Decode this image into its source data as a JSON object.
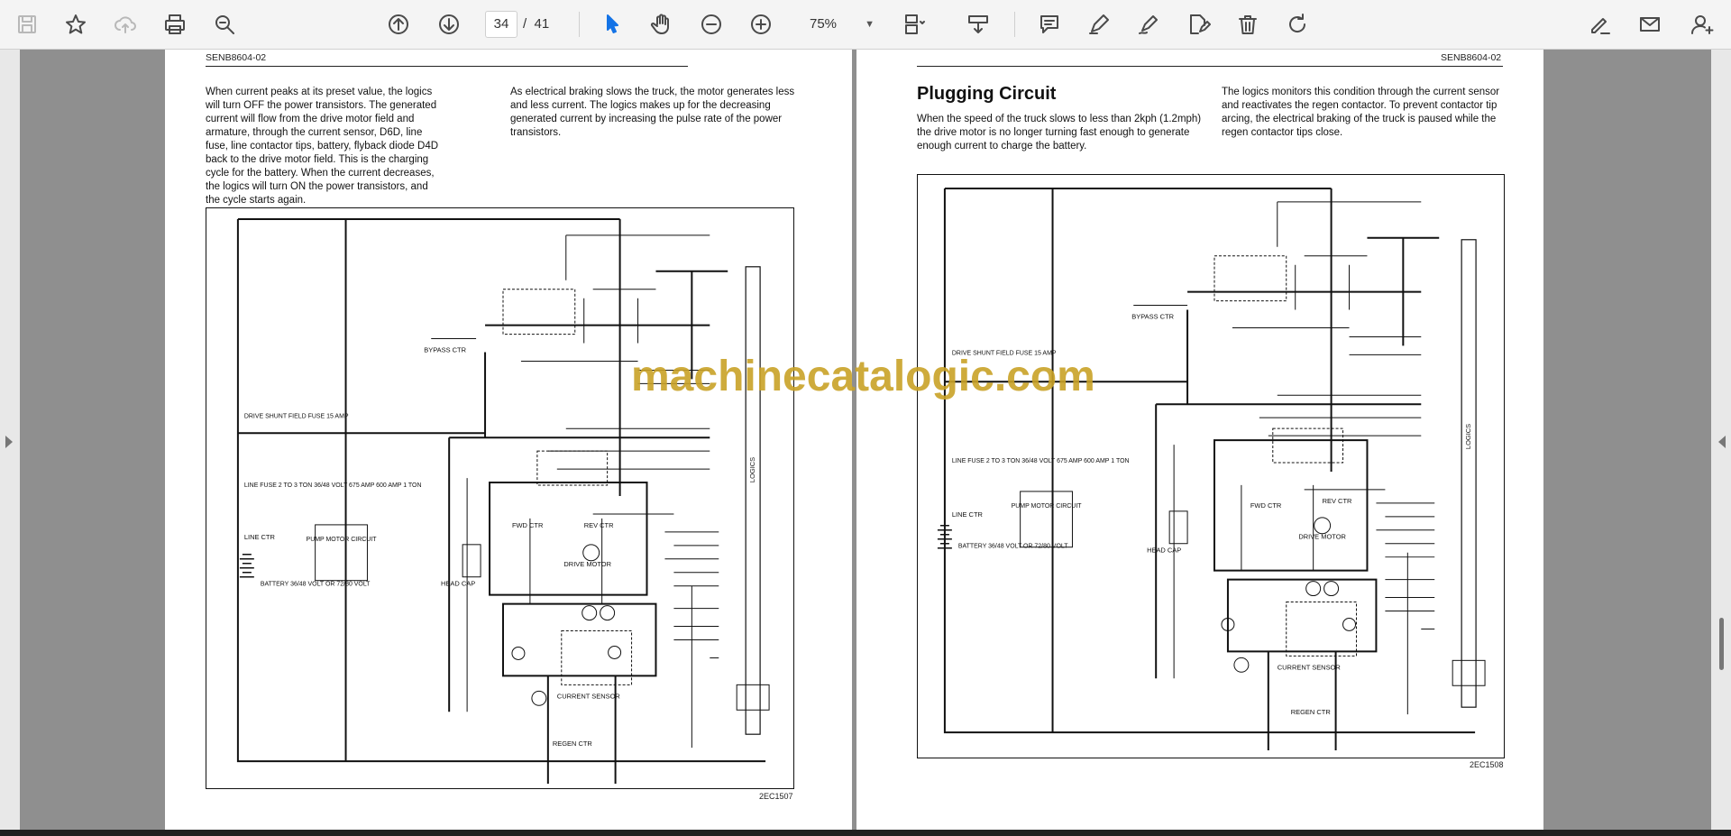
{
  "toolbar": {
    "page_current": "34",
    "page_separator": "/",
    "page_total": "41",
    "zoom": "75%",
    "icons": [
      "save-icon",
      "bookmark-star-icon",
      "cloud-upload-icon",
      "print-icon",
      "zoom-search-icon",
      "page-up-icon",
      "page-down-icon",
      "select-pointer-icon",
      "hand-pan-icon",
      "zoom-out-icon",
      "zoom-in-icon",
      "fit-page-icon",
      "scroll-mode-icon",
      "comment-icon",
      "highlight-pen-icon",
      "draw-icon",
      "edit-document-icon",
      "delete-trash-icon",
      "rotate-icon",
      "sign-icon",
      "email-icon",
      "add-user-icon"
    ]
  },
  "left_page": {
    "doc_id": "SENB8604-02",
    "para_left": "When current peaks at its preset value, the logics will turn OFF the power transistors. The generated current will flow from the drive motor field and armature, through the current sensor, D6D, line fuse, line contactor tips, battery, flyback diode D4D back to the drive motor field. This is the charging cycle for the battery. When the current decreases, the logics will turn ON the power transistors, and the cycle starts again.",
    "para_right": "As electrical braking slows the truck, the motor generates less and less current. The logics makes up for the decreasing generated current by increasing the pulse rate of the power transistors.",
    "figure_code": "2EC1507",
    "labels": {
      "pump": "PUMP MOTOR CIRCUIT",
      "drive_motor": "DRIVE MOTOR",
      "head_cap": "HEAD CAP",
      "battery": "BATTERY 36/48 VOLT OR 72/80 VOLT",
      "line_fuse": "LINE FUSE 2 TO 3 TON 36/48 VOLT 675 AMP 600 AMP 1 TON",
      "line_ctr": "LINE CTR",
      "shunt": "DRIVE SHUNT FIELD FUSE 15 AMP",
      "bypass": "BYPASS CTR",
      "current_sensor": "CURRENT SENSOR",
      "regen": "REGEN CTR",
      "logics": "LOGICS",
      "fwd": "FWD CTR",
      "rev": "REV CTR"
    }
  },
  "right_page": {
    "doc_id": "SENB8604-02",
    "title": "Plugging Circuit",
    "para_left": "When the speed of the truck slows to less than 2kph (1.2mph) the drive motor is no longer turning fast enough to generate enough current to charge the battery.",
    "para_right": "The logics monitors this condition through the current sensor and reactivates the regen contactor. To prevent contactor tip arcing, the electrical braking of the truck is paused while the regen contactor tips close.",
    "figure_code": "2EC1508",
    "labels": {
      "pump": "PUMP MOTOR CIRCUIT",
      "drive_motor": "DRIVE MOTOR",
      "head_cap": "HEAD CAP",
      "battery": "BATTERY 36/48 VOLT OR 72/80 VOLT",
      "line_fuse": "LINE FUSE 2 TO 3 TON 36/48 VOLT 675 AMP 600 AMP 1 TON",
      "line_ctr": "LINE CTR",
      "shunt": "DRIVE SHUNT FIELD FUSE 15 AMP",
      "bypass": "BYPASS CTR",
      "current_sensor": "CURRENT SENSOR",
      "regen": "REGEN CTR",
      "logics": "LOGICS",
      "fwd": "FWD CTR",
      "rev": "REV CTR"
    }
  },
  "watermark": "machinecatalogic.com"
}
